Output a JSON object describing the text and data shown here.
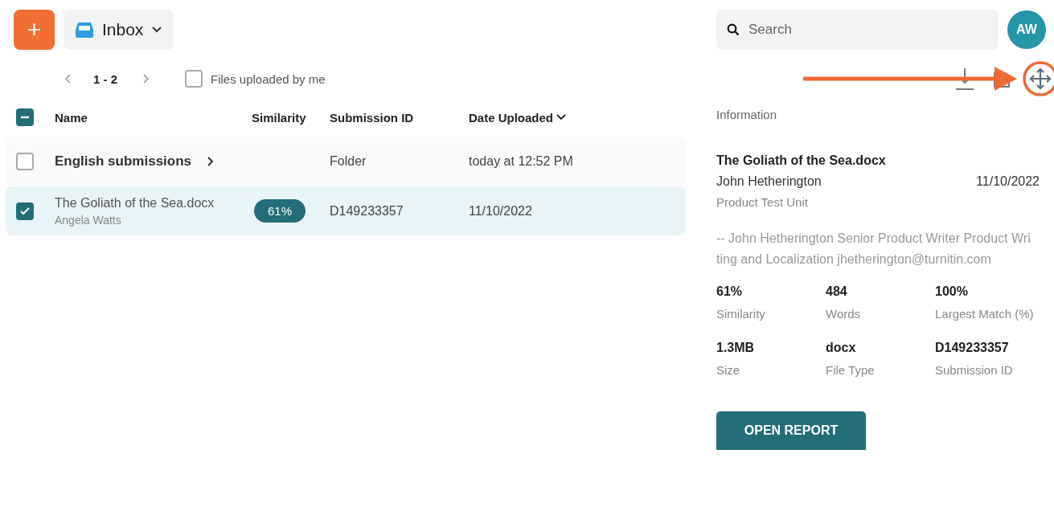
{
  "toolbar": {
    "add_button": "+",
    "folder_menu": "Inbox"
  },
  "pager": {
    "range": "1 - 2",
    "filter": {
      "label": "Files uploaded by me",
      "checked": false
    }
  },
  "table": {
    "header_checkbox": {
      "indeterminate": true
    },
    "columns": [
      "Name",
      "Similarity",
      "Submission ID",
      "Date Uploaded"
    ],
    "rows": [
      {
        "kind": "folder",
        "selected": false,
        "name": "English submissions",
        "submission_id": "Folder",
        "date": "today at 12:52 PM"
      },
      {
        "kind": "file",
        "selected": true,
        "name": "The Goliath of the Sea.docx",
        "author": "Angela Watts",
        "similarity": "61%",
        "submission_id": "D149233357",
        "date": "11/10/2022"
      }
    ]
  },
  "search": {
    "placeholder": "Search"
  },
  "avatar": "AW",
  "info": {
    "heading": "Information",
    "title": "The Goliath of the Sea.docx",
    "author": "John Hetherington",
    "date": "11/10/2022",
    "unit": "Product Test Unit",
    "note": "-- John Hetherington Senior Product Writer Product Writing and Localization jhetherington@turnitin.com",
    "stats": [
      {
        "value": "61%",
        "label": "Similarity"
      },
      {
        "value": "484",
        "label": "Words"
      },
      {
        "value": "100%",
        "label": "Largest Match (%)"
      },
      {
        "value": "1.3MB",
        "label": "Size"
      },
      {
        "value": "docx",
        "label": "File Type"
      },
      {
        "value": "D149233357",
        "label": "Submission ID"
      }
    ],
    "button": "OPEN REPORT"
  }
}
